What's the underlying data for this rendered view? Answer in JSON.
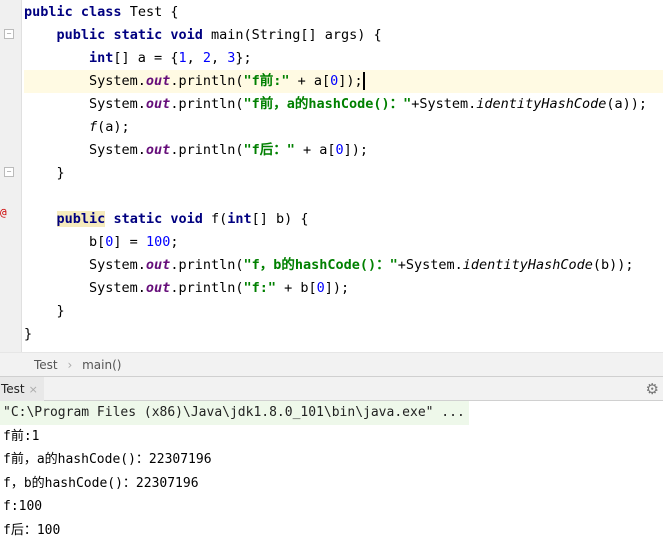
{
  "editor": {
    "lines": [
      [
        [
          "public",
          "kw"
        ],
        [
          " ",
          ""
        ],
        [
          "class",
          "kw"
        ],
        [
          " Test {",
          ""
        ]
      ],
      [
        [
          "    ",
          ""
        ],
        [
          "public",
          "kw"
        ],
        [
          " ",
          ""
        ],
        [
          "static",
          "kw"
        ],
        [
          " ",
          ""
        ],
        [
          "void",
          "kw"
        ],
        [
          " main(String[] args) {",
          ""
        ]
      ],
      [
        [
          "        ",
          ""
        ],
        [
          "int",
          "kw"
        ],
        [
          "[] a = {",
          ""
        ],
        [
          "1",
          "num"
        ],
        [
          ", ",
          ""
        ],
        [
          "2",
          "num"
        ],
        [
          ", ",
          ""
        ],
        [
          "3",
          "num"
        ],
        [
          "};",
          ""
        ]
      ],
      [
        [
          "        System.",
          ""
        ],
        [
          "out",
          "fld"
        ],
        [
          ".println(",
          ""
        ],
        [
          "\"f前:\"",
          "str"
        ],
        [
          " + a[",
          ""
        ],
        [
          "0",
          "num"
        ],
        [
          "]);",
          ""
        ]
      ],
      [
        [
          "        System.",
          ""
        ],
        [
          "out",
          "fld"
        ],
        [
          ".println(",
          ""
        ],
        [
          "\"f前，a的hashCode()：\"",
          "str"
        ],
        [
          "+System.",
          ""
        ],
        [
          "identityHashCode",
          "it"
        ],
        [
          "(a));",
          ""
        ]
      ],
      [
        [
          "        ",
          ""
        ],
        [
          "f",
          "it"
        ],
        [
          "(a);",
          ""
        ]
      ],
      [
        [
          "        System.",
          ""
        ],
        [
          "out",
          "fld"
        ],
        [
          ".println(",
          ""
        ],
        [
          "\"f后：\"",
          "str"
        ],
        [
          " + a[",
          ""
        ],
        [
          "0",
          "num"
        ],
        [
          "]);",
          ""
        ]
      ],
      [
        [
          "    }",
          ""
        ]
      ],
      [],
      [
        [
          "    ",
          ""
        ],
        [
          "public",
          "kw hl"
        ],
        [
          " ",
          ""
        ],
        [
          "static",
          "kw"
        ],
        [
          " ",
          ""
        ],
        [
          "void",
          "kw"
        ],
        [
          " f(",
          ""
        ],
        [
          "int",
          "kw"
        ],
        [
          "[] b) {",
          ""
        ]
      ],
      [
        [
          "        b[",
          ""
        ],
        [
          "0",
          "num"
        ],
        [
          "] = ",
          ""
        ],
        [
          "100",
          "num"
        ],
        [
          ";",
          ""
        ]
      ],
      [
        [
          "        System.",
          ""
        ],
        [
          "out",
          "fld"
        ],
        [
          ".println(",
          ""
        ],
        [
          "\"f，b的hashCode()：\"",
          "str"
        ],
        [
          "+System.",
          ""
        ],
        [
          "identityHashCode",
          "it"
        ],
        [
          "(b));",
          ""
        ]
      ],
      [
        [
          "        System.",
          ""
        ],
        [
          "out",
          "fld"
        ],
        [
          ".println(",
          ""
        ],
        [
          "\"f:\"",
          "str"
        ],
        [
          " + b[",
          ""
        ],
        [
          "0",
          "num"
        ],
        [
          "]);",
          ""
        ]
      ],
      [
        [
          "    }",
          ""
        ]
      ],
      [
        [
          "}",
          ""
        ]
      ]
    ]
  },
  "breadcrumb": {
    "items": [
      "Test",
      "main()"
    ],
    "separator": "›"
  },
  "run_panel": {
    "tab_label": "Test",
    "close": "×",
    "gear": "⚙"
  },
  "console": {
    "command": "\"C:\\Program Files (x86)\\Java\\jdk1.8.0_101\\bin\\java.exe\" ...",
    "output": [
      "f前:1",
      "f前，a的hashCode()：22307196",
      "f，b的hashCode()：22307196",
      "f:100",
      "f后：100"
    ]
  }
}
